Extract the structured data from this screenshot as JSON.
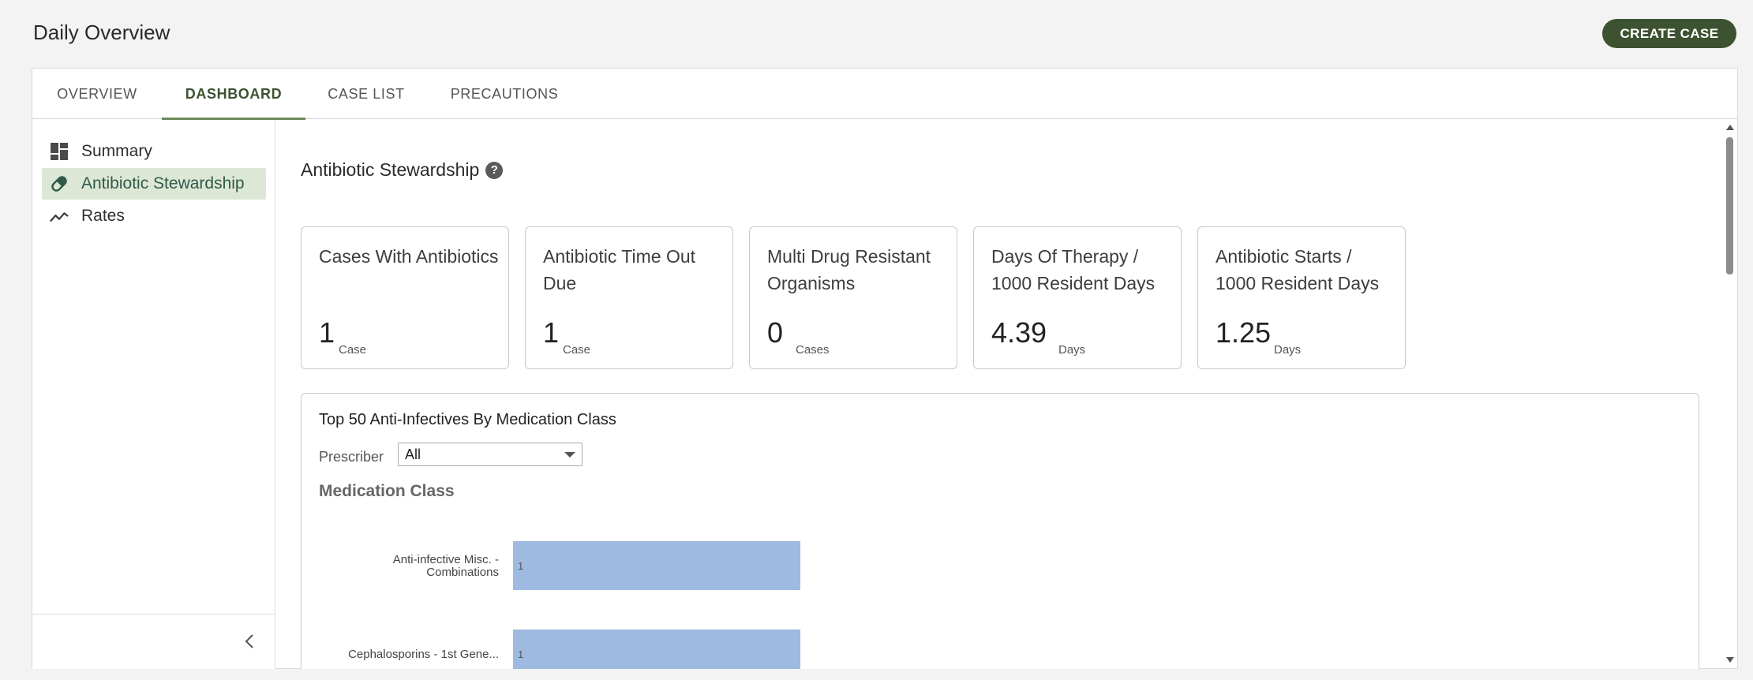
{
  "header": {
    "title": "Daily Overview",
    "create_case_label": "CREATE CASE"
  },
  "tabs": [
    {
      "label": "OVERVIEW",
      "active": false
    },
    {
      "label": "DASHBOARD",
      "active": true
    },
    {
      "label": "CASE LIST",
      "active": false
    },
    {
      "label": "PRECAUTIONS",
      "active": false
    }
  ],
  "sidebar": {
    "items": [
      {
        "label": "Summary",
        "icon": "dashboard-grid-icon",
        "active": false
      },
      {
        "label": "Antibiotic Stewardship",
        "icon": "pill-icon",
        "active": true
      },
      {
        "label": "Rates",
        "icon": "trending-icon",
        "active": false
      }
    ],
    "collapse_icon": "chevron-left-icon"
  },
  "main": {
    "section_title": "Antibiotic Stewardship",
    "help_icon": "question-circle-icon",
    "stats": [
      {
        "title": "Cases With Antibiotics",
        "value": "1",
        "unit": "Case"
      },
      {
        "title": "Antibiotic Time Out Due",
        "value": "1",
        "unit": "Case"
      },
      {
        "title": "Multi Drug Resistant Organisms",
        "value": "0",
        "unit": "Cases"
      },
      {
        "title": "Days Of Therapy / 1000 Resident Days",
        "value": "4.39",
        "unit": "Days"
      },
      {
        "title": "Antibiotic Starts / 1000 Resident Days",
        "value": "1.25",
        "unit": "Days"
      }
    ],
    "chart_panel": {
      "title": "Top 50 Anti-Infectives By Medication Class",
      "prescriber_label": "Prescriber",
      "prescriber_value": "All",
      "medication_class_label": "Medication Class"
    }
  },
  "chart_data": {
    "type": "bar",
    "orientation": "horizontal",
    "categories": [
      "Anti-infective Misc. - Combinations",
      "Cephalosporins - 1st Gene..."
    ],
    "category_label_lines": [
      [
        "Anti-infective Misc. -",
        "Combinations"
      ],
      [
        "Cephalosporins - 1st Gene..."
      ]
    ],
    "values": [
      1,
      1
    ],
    "bar_color": "#9ebae0",
    "xlim": [
      0,
      1
    ]
  },
  "colors": {
    "accent": "#3d5230",
    "active_tab_underline": "#6c8a5a",
    "active_sidebar_bg": "#dde7d5",
    "bar": "#9ebae0"
  }
}
